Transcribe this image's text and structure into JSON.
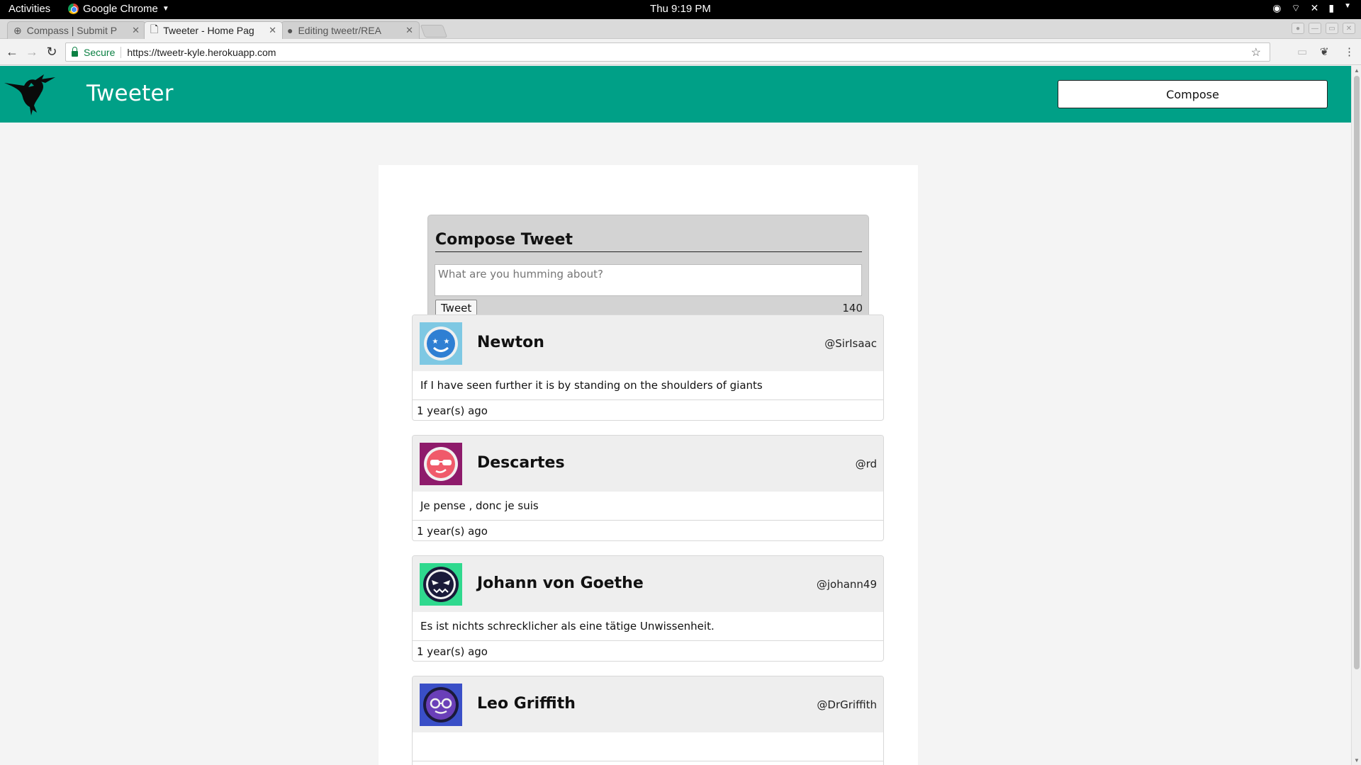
{
  "system": {
    "activities": "Activities",
    "app_name": "Google Chrome",
    "clock": "Thu  9:19 PM"
  },
  "browser": {
    "tabs": [
      {
        "label": "Compass | Submit P"
      },
      {
        "label": "Tweeter - Home Pag"
      },
      {
        "label": "Editing tweetr/REA"
      }
    ],
    "secure_label": "Secure",
    "url": "https://tweetr-kyle.herokuapp.com"
  },
  "site": {
    "brand": "Tweeter",
    "compose_label": "Compose",
    "colors": {
      "nav": "#00a087"
    }
  },
  "composer": {
    "title": "Compose Tweet",
    "placeholder": "What are you humming about?",
    "submit_label": "Tweet",
    "counter": "140"
  },
  "tweets": [
    {
      "name": "Newton",
      "handle": "@SirIsaac",
      "text": "If I have seen further it is by standing on the shoulders of giants",
      "age": "1 year(s) ago"
    },
    {
      "name": "Descartes",
      "handle": "@rd",
      "text": "Je pense , donc je suis",
      "age": "1 year(s) ago"
    },
    {
      "name": "Johann von Goethe",
      "handle": "@johann49",
      "text": "Es ist nichts schrecklicher als eine tätige Unwissenheit.",
      "age": "1 year(s) ago"
    },
    {
      "name": "Leo Griffith",
      "handle": "@DrGriffith",
      "text": "",
      "age": ""
    }
  ]
}
